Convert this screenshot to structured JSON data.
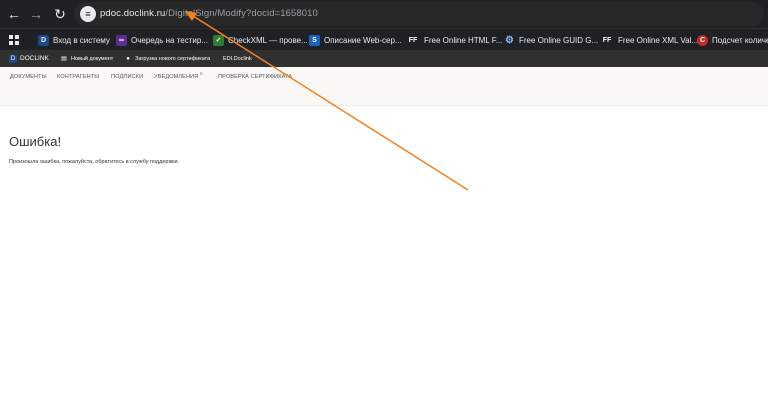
{
  "browser": {
    "url_host": "pdoc.doclink.ru",
    "url_path": "/DigitalSign/Modify?docid=1658010",
    "bookmarks": [
      {
        "label": "Вход в систему",
        "icon": "D"
      },
      {
        "label": "Очередь на тестир...",
        "icon": "vs"
      },
      {
        "label": "CheckXML — прове...",
        "icon": "cx"
      },
      {
        "label": "Описание Web-сер...",
        "icon": "S"
      },
      {
        "label": "Free Online HTML F...",
        "icon": "FF"
      },
      {
        "label": "Free Online GUID G...",
        "icon": "gear"
      },
      {
        "label": "Free Online XML Val...",
        "icon": "FF"
      },
      {
        "label": "Подсчет количе",
        "icon": "C"
      }
    ]
  },
  "site": {
    "logo": "DOCLINK",
    "header_links": [
      "Новый документ",
      "Загрузка нового сертификата",
      "EDI.Doclink"
    ],
    "nav": [
      "ДОКУМЕНТЫ",
      "КОНТРАГЕНТЫ",
      "ПОДПИСКИ",
      "УВЕДОМЛЕНИЯ",
      "ПРОВЕРКА СЕРТИФИКАТА"
    ],
    "notifications_count": "0"
  },
  "error": {
    "title": "Ошибка!",
    "message": "Произошла ошибка, пожалуйста, обратитесь в службу поддержки."
  },
  "colors": {
    "chrome_bg": "#202124",
    "header_bg": "#303030",
    "annotation_arrow": "#f5821f"
  }
}
